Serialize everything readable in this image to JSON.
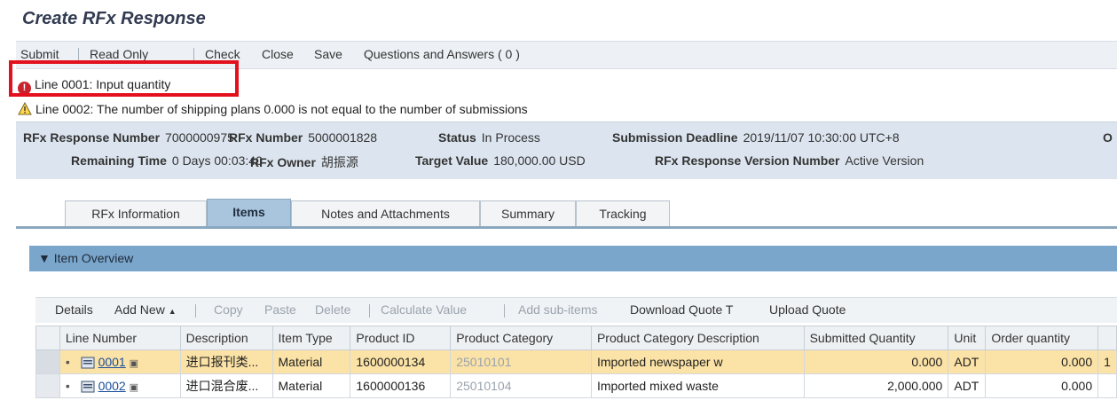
{
  "title": "Create RFx Response",
  "toolbar": {
    "submit": "Submit",
    "read_only": "Read Only",
    "check": "Check",
    "close": "Close",
    "save": "Save",
    "qa": "Questions and Answers ( 0 )"
  },
  "messages": {
    "error": "Line 0001: Input quantity",
    "warning": "Line 0002: The number of shipping plans 0.000 is not equal to the number of submissions"
  },
  "header": {
    "response_number_label": "RFx Response Number",
    "response_number": "7000000975",
    "rfx_number_label": "RFx Number",
    "rfx_number": "5000001828",
    "status_label": "Status",
    "status": "In Process",
    "deadline_label": "Submission Deadline",
    "deadline": "2019/11/07 10:30:00 UTC+8",
    "cutoff": "O",
    "remaining_label": "Remaining Time",
    "remaining": "0 Days 00:03:40",
    "owner_label": "RFx Owner",
    "owner": "胡振源",
    "target_label": "Target Value",
    "target": "180,000.00 USD",
    "version_label": "RFx Response Version Number",
    "version": "Active Version"
  },
  "tabs": [
    "RFx Information",
    "Items",
    "Notes and Attachments",
    "Summary",
    "Tracking"
  ],
  "section": {
    "label": "Item Overview"
  },
  "table_toolbar": {
    "details": "Details",
    "add_new": "Add New",
    "copy": "Copy",
    "paste": "Paste",
    "delete": "Delete",
    "calculate": "Calculate Value",
    "add_sub": "Add sub-items",
    "download": "Download Quote T",
    "upload": "Upload Quote"
  },
  "columns": [
    "Line Number",
    "Description",
    "Item Type",
    "Product ID",
    "Product Category",
    "Product Category Description",
    "Submitted Quantity",
    "Unit",
    "Order quantity"
  ],
  "rows": [
    {
      "line": "0001",
      "desc": "进口报刊类...",
      "type": "Material",
      "pid": "1600000134",
      "cat": "25010101",
      "catdesc": "Imported newspaper w",
      "qty": "0.000",
      "unit": "ADT",
      "order": "0.000",
      "extra": "1"
    },
    {
      "line": "0002",
      "desc": "进口混合废...",
      "type": "Material",
      "pid": "1600000136",
      "cat": "25010104",
      "catdesc": "Imported mixed waste",
      "qty": "2,000.000",
      "unit": "ADT",
      "order": "0.000",
      "extra": ""
    }
  ]
}
